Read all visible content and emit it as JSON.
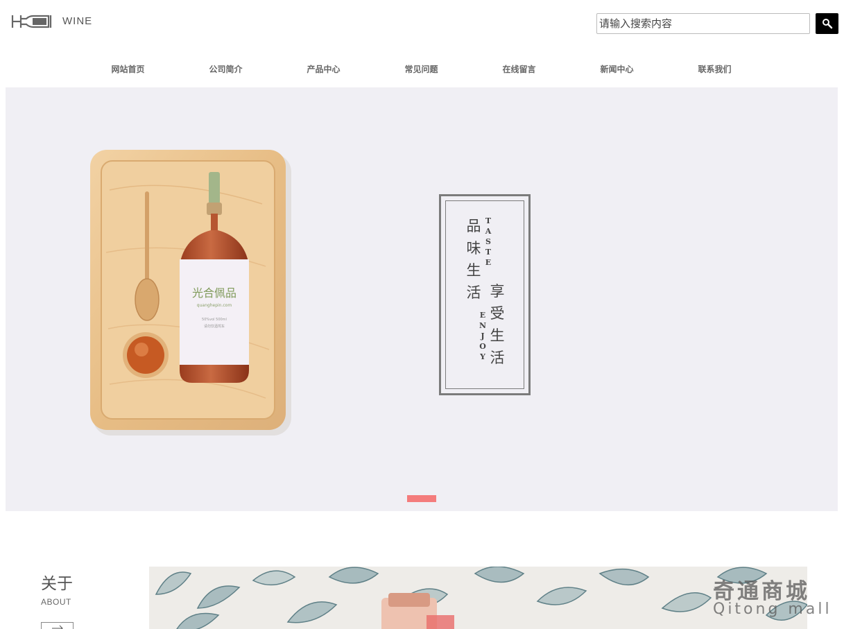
{
  "header": {
    "logo_text": "WINE",
    "logo_icon": "wine-bottle-logo"
  },
  "search": {
    "placeholder": "请输入搜索内容",
    "button_icon": "search-icon"
  },
  "nav": {
    "items": [
      "网站首页",
      "公司简介",
      "产品中心",
      "常见问题",
      "在线留言",
      "新闻中心",
      "联系我们"
    ]
  },
  "banner": {
    "product_label": "光合佩品",
    "product_sublabel": "quanghepin.com",
    "product_volume": "50%vol 500ml",
    "product_note": "请勿饮酒驾车",
    "taste_cn": [
      "品",
      "味",
      "生",
      "活"
    ],
    "taste_en": [
      "T",
      "A",
      "S",
      "T",
      "E"
    ],
    "enjoy_cn": [
      "享",
      "受",
      "生",
      "活"
    ],
    "enjoy_en": [
      "E",
      "N",
      "J",
      "O",
      "Y"
    ],
    "indicator_color": "#f47c7c",
    "background_color": "#f0eff4"
  },
  "about": {
    "title": "关于",
    "subtitle": "ABOUT",
    "arrow_icon": "arrow-right-icon"
  },
  "watermark": {
    "cn": "奇通商城",
    "en": "Qitong mall"
  }
}
